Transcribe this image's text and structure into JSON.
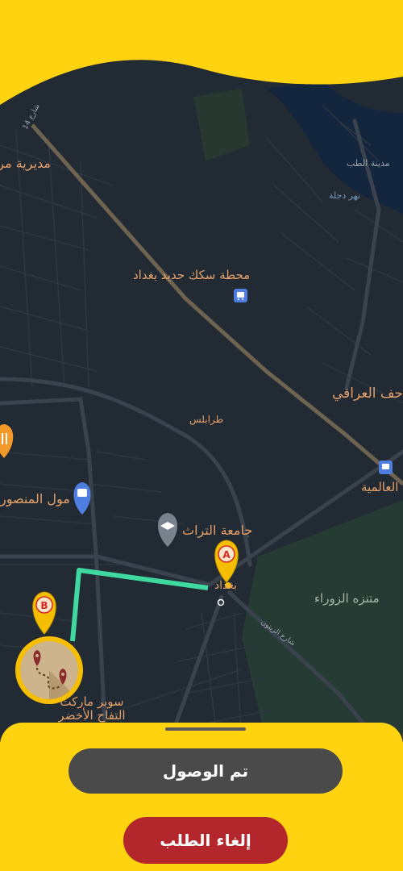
{
  "map": {
    "labels": [
      {
        "id": "district-office",
        "text": "مديرية مر"
      },
      {
        "id": "railway-station",
        "text": "محطة سكك حديد بغداد"
      },
      {
        "id": "medical-city",
        "text": "مدينة الطب"
      },
      {
        "id": "tigris-river",
        "text": "نهر دجلة"
      },
      {
        "id": "iraqi-museum",
        "text": "حف العراقي"
      },
      {
        "id": "tripoli",
        "text": "طرابلس"
      },
      {
        "id": "almiya",
        "text": "العالمية"
      },
      {
        "id": "mansour-mall",
        "text": "مول المنصور"
      },
      {
        "id": "heritage-university",
        "text": "جامعة التراث"
      },
      {
        "id": "baghdad-point",
        "text": "بغداد"
      },
      {
        "id": "zawraa-park",
        "text": "متنزه الزوراء"
      },
      {
        "id": "supermarket",
        "text": "سوبر ماركت التفاح الأخضر"
      },
      {
        "id": "street-14",
        "text": "شارع 14"
      },
      {
        "id": "street-zaytoun",
        "text": "شارع الزيتون"
      }
    ],
    "markers": {
      "a": "A",
      "b": "B"
    },
    "colors": {
      "route": "#3FD9A0",
      "marker": "#F6BE00",
      "park": "#263B33"
    }
  },
  "actions": {
    "arrived_label": "تم الوصول",
    "cancel_label": "إلغاء الطلب"
  }
}
